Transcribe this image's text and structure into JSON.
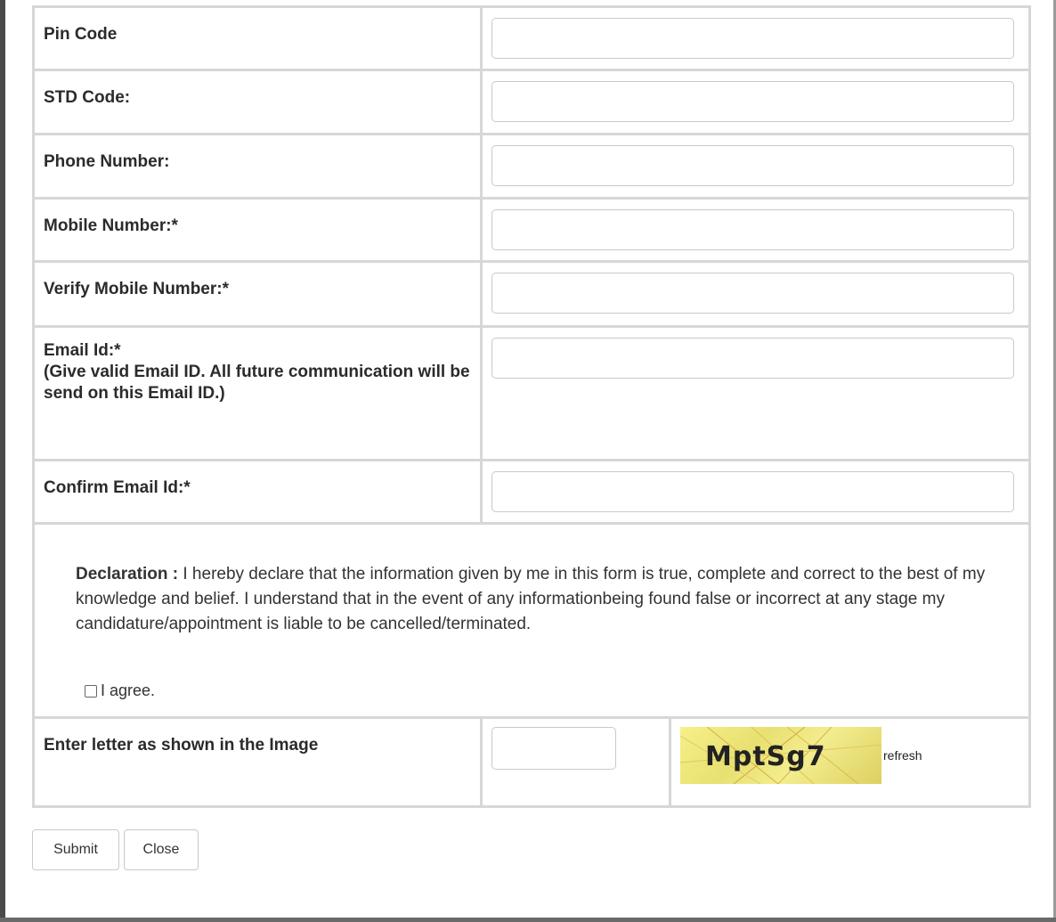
{
  "form": {
    "rows": [
      {
        "label": "Pin Code",
        "value": ""
      },
      {
        "label": "STD Code:",
        "value": ""
      },
      {
        "label": "Phone Number:",
        "value": ""
      },
      {
        "label": "Mobile Number:*",
        "value": ""
      },
      {
        "label": "Verify Mobile Number:*",
        "value": ""
      },
      {
        "label": "Email Id:*\n(Give valid Email ID. All future communication will be send on this Email ID.)",
        "value": ""
      },
      {
        "label": "Confirm Email Id:*",
        "value": ""
      }
    ]
  },
  "declaration": {
    "lead": "Declaration :",
    "text": " I hereby declare that the information given by me in this form is true, complete and correct to the best of my knowledge and belief. I understand that in the event of any informationbeing found false or incorrect at any stage my candidature/appointment is liable to be cancelled/terminated.",
    "agree_label": "I agree."
  },
  "captcha": {
    "label": "Enter letter as shown in the Image",
    "code": "MptSg7",
    "refresh": "refresh"
  },
  "buttons": {
    "submit": "Submit",
    "close": "Close"
  }
}
